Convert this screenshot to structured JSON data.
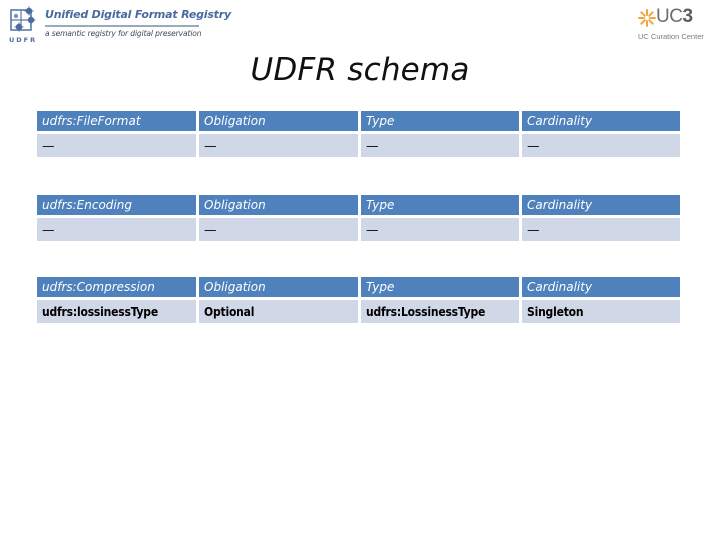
{
  "header": {
    "site_title": "Unified Digital Format Registry",
    "tagline": "a semantic registry for digital preservation",
    "udfr_logo_letters": "UDFR",
    "udfr_logo_icon": "network-nodes-icon",
    "partner_logo": {
      "name": "UC3",
      "prefix": "UC",
      "suffix": "3",
      "subtitle": "UC Curation Center",
      "icon": "sunburst-star-icon",
      "accent_color": "#f3a53a"
    }
  },
  "slide": {
    "title": "UDFR schema"
  },
  "colors": {
    "header_row": "#4f81bd",
    "data_row": "#d0d8e8",
    "brand_blue": "#4a6aa0"
  },
  "tables": [
    {
      "headers": [
        "udfrs:FileFormat",
        "Obligation",
        "Type",
        "Cardinality"
      ],
      "rows": [
        [
          "—",
          "—",
          "—",
          "—"
        ]
      ]
    },
    {
      "headers": [
        "udfrs:Encoding",
        "Obligation",
        "Type",
        "Cardinality"
      ],
      "rows": [
        [
          "—",
          "—",
          "—",
          "—"
        ]
      ]
    },
    {
      "headers": [
        "udfrs:Compression",
        "Obligation",
        "Type",
        "Cardinality"
      ],
      "rows": [
        [
          "udfrs:lossinessType",
          "Optional",
          "udfrs:LossinessType",
          "Singleton"
        ]
      ]
    }
  ]
}
